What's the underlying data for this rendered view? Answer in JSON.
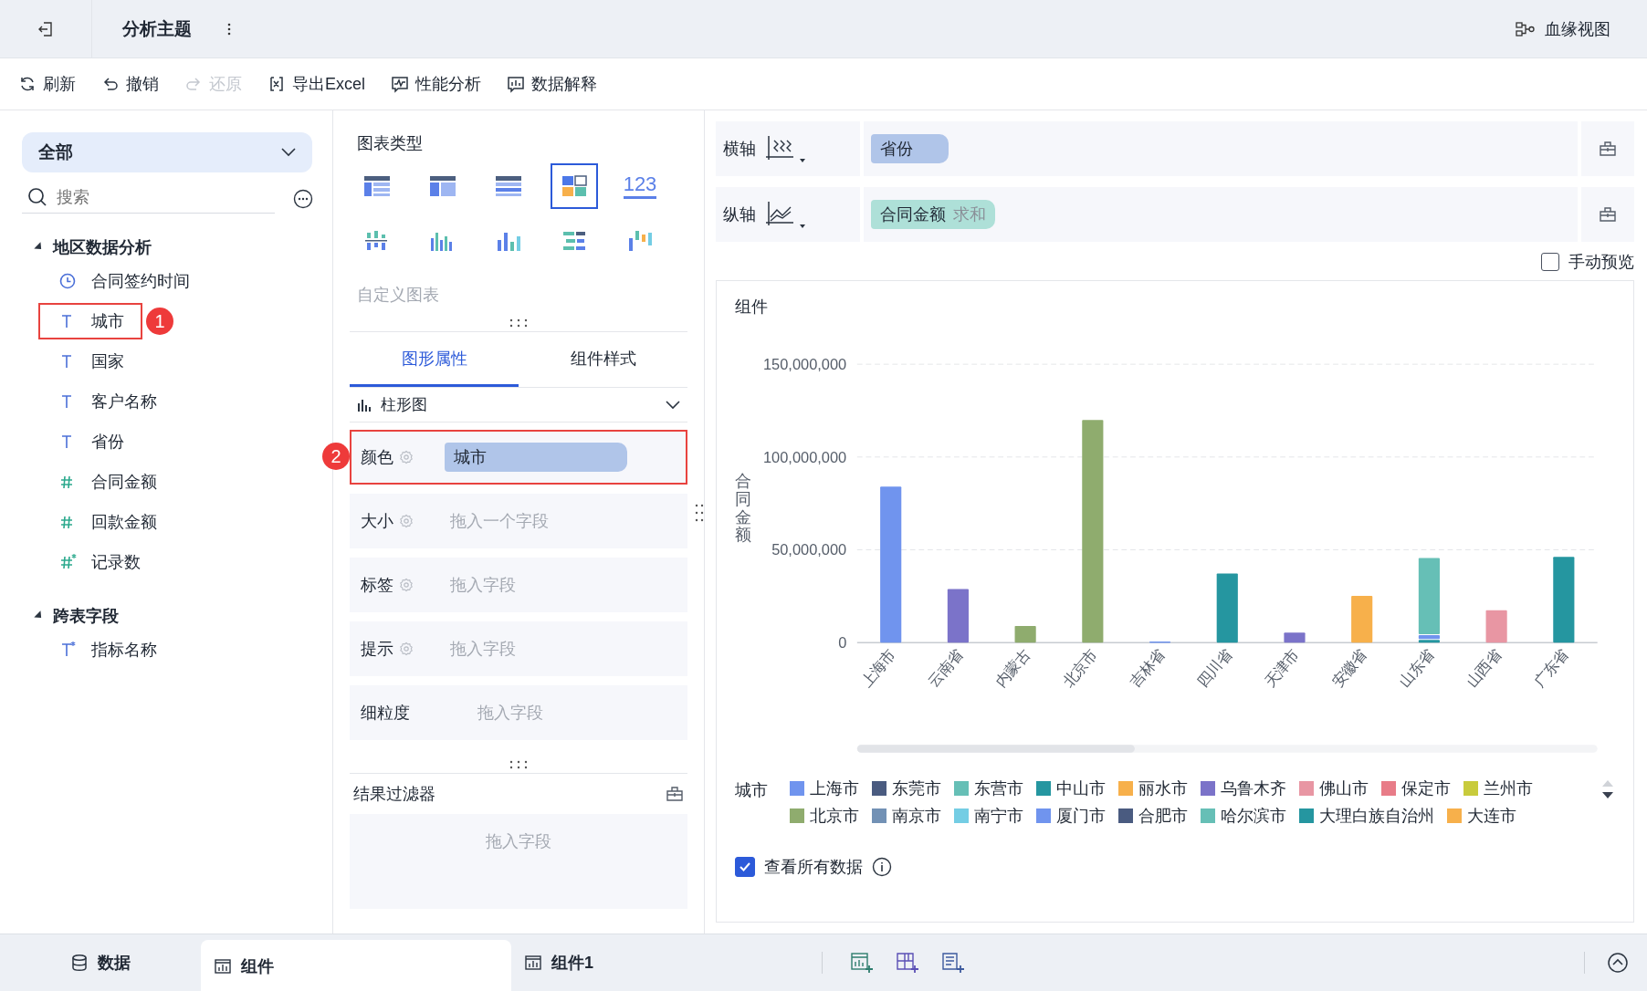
{
  "header": {
    "title": "分析主题",
    "lineage": "血缘视图"
  },
  "toolbar": [
    {
      "kind": "refresh",
      "label": "刷新",
      "disabled": false
    },
    {
      "kind": "undo",
      "label": "撤销",
      "disabled": false
    },
    {
      "kind": "redo",
      "label": "还原",
      "disabled": true
    },
    {
      "kind": "excel",
      "label": "导出Excel",
      "disabled": false
    },
    {
      "kind": "perf",
      "label": "性能分析",
      "disabled": false
    },
    {
      "kind": "explain",
      "label": "数据解释",
      "disabled": false
    }
  ],
  "sidebar": {
    "scope": "全部",
    "search": {
      "placeholder": "搜索"
    },
    "groups": [
      {
        "label": "地区数据分析",
        "expanded": true,
        "children": [
          {
            "kind": "date",
            "label": "合同签约时间"
          },
          {
            "kind": "text",
            "label": "城市",
            "callout": "1"
          },
          {
            "kind": "text",
            "label": "国家"
          },
          {
            "kind": "text",
            "label": "客户名称"
          },
          {
            "kind": "text",
            "label": "省份"
          },
          {
            "kind": "number",
            "label": "合同金额"
          },
          {
            "kind": "number",
            "label": "回款金额"
          },
          {
            "kind": "calc_number",
            "label": "记录数"
          }
        ]
      },
      {
        "label": "跨表字段",
        "expanded": true,
        "children": [
          {
            "kind": "calc_text",
            "label": "指标名称"
          }
        ]
      }
    ]
  },
  "chart_types": {
    "title": "图表类型",
    "custom": "自定义图表",
    "items": [
      {
        "kind": "table",
        "selected": false
      },
      {
        "kind": "crosstab",
        "selected": false
      },
      {
        "kind": "detail",
        "selected": false
      },
      {
        "kind": "tile",
        "selected": true
      },
      {
        "kind": "number",
        "label": "123",
        "selected": false
      },
      {
        "kind": "dot",
        "selected": false
      },
      {
        "kind": "multibar",
        "selected": false
      },
      {
        "kind": "bar",
        "selected": false
      },
      {
        "kind": "hbar",
        "selected": false
      },
      {
        "kind": "range",
        "selected": false
      }
    ]
  },
  "prop_tabs": [
    {
      "label": "图形属性",
      "selected": true
    },
    {
      "label": "组件样式",
      "selected": false
    }
  ],
  "mark_type": "柱形图",
  "drops": [
    {
      "label": "颜色",
      "gear": true,
      "field": "城市",
      "callout": "2"
    },
    {
      "label": "大小",
      "gear": true,
      "placeholder": "拖入一个字段"
    },
    {
      "label": "标签",
      "gear": true,
      "placeholder": "拖入字段"
    },
    {
      "label": "提示",
      "gear": true,
      "placeholder": "拖入字段"
    },
    {
      "label": "细粒度",
      "placeholder": "拖入字段"
    }
  ],
  "filter": {
    "title": "结果过滤器",
    "placeholder": "拖入字段"
  },
  "axes": [
    {
      "kind": "x",
      "label": "横轴",
      "field": "省份"
    },
    {
      "kind": "y",
      "label": "纵轴",
      "field": "合同金额",
      "agg": "求和"
    }
  ],
  "manual_preview": {
    "label": "手动预览",
    "checked": false
  },
  "widget": {
    "title": "组件",
    "chart_data": {
      "type": "bar",
      "stacked": true,
      "ylabel": "合同金额",
      "categories": [
        "上海市",
        "云南省",
        "内蒙古",
        "北京市",
        "吉林省",
        "四川省",
        "天津市",
        "安徽省",
        "山东省",
        "山西省",
        "广东省"
      ],
      "ylim": [
        0,
        150000000
      ],
      "yticks": [
        {
          "value": 0,
          "label": "0"
        },
        {
          "value": 50000000,
          "label": "50,000,000"
        },
        {
          "value": 100000000,
          "label": "100,000,000"
        },
        {
          "value": 150000000,
          "label": "150,000,000"
        }
      ],
      "series": [
        {
          "name": "上海市",
          "color": "#7094ee",
          "values": [
            84000000,
            null,
            null,
            null,
            600000,
            null,
            null,
            null,
            null,
            null,
            null
          ]
        },
        {
          "name": "东莞市",
          "color": "#4a5b80",
          "values": [
            null,
            null,
            null,
            null,
            null,
            null,
            null,
            null,
            null,
            null,
            null
          ]
        },
        {
          "name": "东营市",
          "color": "#66bfb6",
          "values": [
            null,
            null,
            null,
            null,
            null,
            null,
            null,
            null,
            null,
            null,
            null
          ]
        },
        {
          "name": "中山市",
          "color": "#2596a0",
          "values": [
            null,
            null,
            null,
            null,
            null,
            37200000,
            null,
            null,
            1500000,
            null,
            46200000
          ]
        },
        {
          "name": "丽水市",
          "color": "#f7b04b",
          "values": [
            null,
            null,
            null,
            null,
            null,
            null,
            null,
            25200000,
            null,
            null,
            null
          ]
        },
        {
          "name": "乌鲁木齐",
          "color": "#7b73c9",
          "values": [
            null,
            28800000,
            null,
            null,
            null,
            null,
            5400000,
            null,
            null,
            null,
            null
          ]
        },
        {
          "name": "佛山市",
          "color": "#e896a3",
          "values": [
            null,
            null,
            null,
            null,
            null,
            null,
            null,
            null,
            null,
            17400000,
            null
          ]
        },
        {
          "name": "保定市",
          "color": "#e87c88",
          "values": [
            null,
            null,
            null,
            null,
            null,
            null,
            null,
            null,
            null,
            null,
            null
          ]
        },
        {
          "name": "兰州市",
          "color": "#c8cb3c",
          "values": [
            null,
            null,
            null,
            null,
            null,
            null,
            null,
            null,
            null,
            null,
            null
          ]
        },
        {
          "name": "北京市",
          "color": "#8fac6e",
          "values": [
            null,
            null,
            9000000,
            120000000,
            null,
            null,
            null,
            null,
            null,
            null,
            null
          ]
        },
        {
          "name": "南京市",
          "color": "#7291b5",
          "values": [
            null,
            null,
            null,
            null,
            null,
            null,
            null,
            null,
            null,
            null,
            null
          ]
        },
        {
          "name": "南宁市",
          "color": "#74cde4",
          "values": [
            null,
            null,
            null,
            null,
            null,
            null,
            null,
            null,
            null,
            null,
            null
          ]
        },
        {
          "name": "厦门市",
          "color": "#7094ee",
          "values": [
            null,
            null,
            null,
            null,
            null,
            null,
            null,
            null,
            2500000,
            null,
            null
          ]
        },
        {
          "name": "合肥市",
          "color": "#4a5b80",
          "values": [
            null,
            null,
            null,
            null,
            null,
            null,
            null,
            null,
            null,
            null,
            null
          ]
        },
        {
          "name": "哈尔滨市",
          "color": "#66bfb6",
          "values": [
            null,
            null,
            null,
            null,
            null,
            null,
            null,
            null,
            41600000,
            null,
            null
          ]
        },
        {
          "name": "大理白族自治州",
          "color": "#2596a0",
          "values": [
            null,
            null,
            null,
            null,
            null,
            null,
            null,
            null,
            null,
            null,
            null
          ]
        },
        {
          "name": "大连市",
          "color": "#f7b04b",
          "values": [
            null,
            null,
            null,
            null,
            null,
            null,
            null,
            null,
            null,
            null,
            null
          ]
        }
      ]
    },
    "legend_title": "城市",
    "view_all": {
      "label": "查看所有数据",
      "checked": true
    }
  },
  "bottom_tabs": [
    {
      "kind": "data",
      "label": "数据",
      "selected": false
    },
    {
      "kind": "widget",
      "label": "组件",
      "selected": true
    },
    {
      "kind": "widget",
      "label": "组件1",
      "selected": false
    }
  ]
}
